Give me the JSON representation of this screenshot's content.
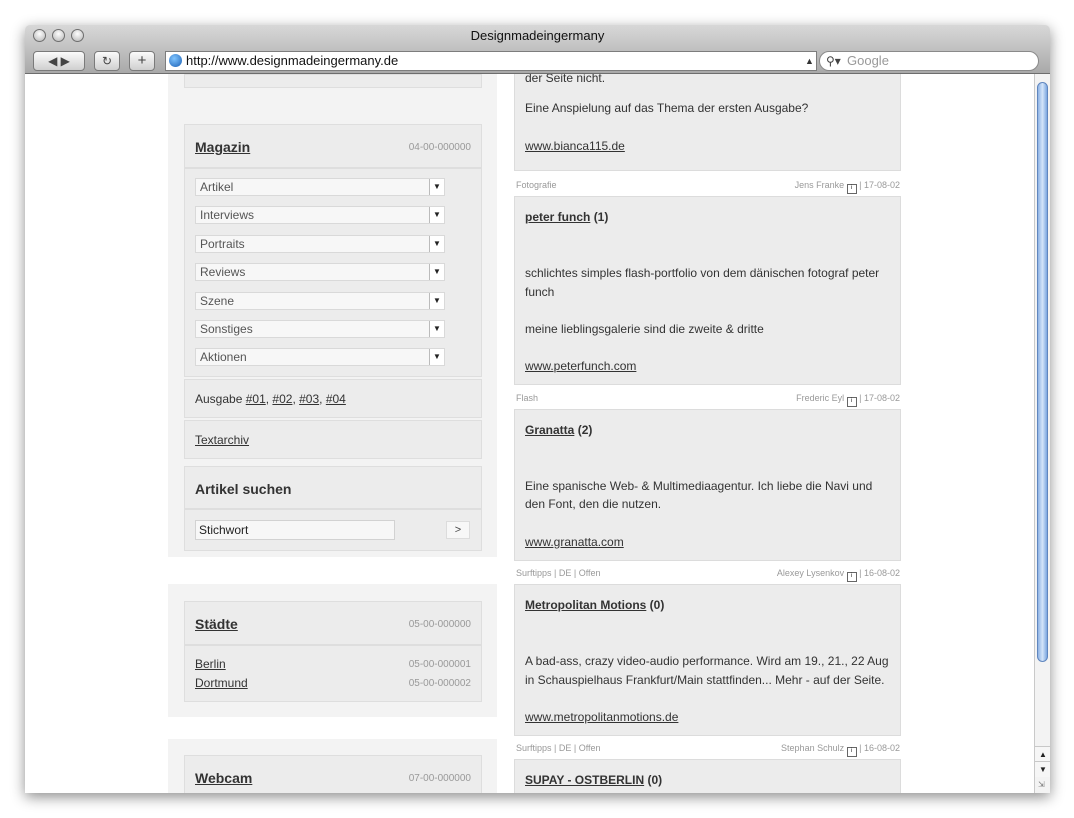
{
  "browser": {
    "title": "Designmadeingermany",
    "url": "http://www.designmadeingermany.de",
    "search_placeholder": "Google"
  },
  "magazin": {
    "heading": "Magazin",
    "code": "04-00-000000",
    "menus": [
      "Artikel",
      "Interviews",
      "Portraits",
      "Reviews",
      "Szene",
      "Sonstiges",
      "Aktionen"
    ],
    "ausgabe_label": "Ausgabe",
    "issues": [
      "#01",
      "#02",
      "#03",
      "#04"
    ],
    "textarchiv": "Textarchiv"
  },
  "search": {
    "heading": "Artikel suchen",
    "input_value": "Stichwort",
    "button": ">"
  },
  "staedte": {
    "heading": "Städte",
    "code": "05-00-000000",
    "items": [
      {
        "name": "Berlin",
        "code": "05-00-000001"
      },
      {
        "name": "Dortmund",
        "code": "05-00-000002"
      }
    ]
  },
  "webcam": {
    "heading": "Webcam",
    "code": "07-00-000000"
  },
  "first_post": {
    "partial": "der Seite nicht.",
    "text": "Eine Anspielung auf das Thema der ersten Ausgabe?",
    "link": "www.bianca115.de"
  },
  "posts": [
    {
      "category": "Fotografie",
      "author": "Jens Franke",
      "date": "| 17-08-02",
      "title": "peter funch",
      "count": "(1)",
      "body1": "schlichtes simples flash-portfolio von dem dänischen fotograf peter",
      "body2": "funch",
      "body3": "meine lieblingsgalerie sind die zweite & dritte",
      "link": "www.peterfunch.com"
    },
    {
      "category": "Flash",
      "author": "Frederic Eyl",
      "date": "| 17-08-02",
      "title": "Granatta",
      "count": "(2)",
      "body1": "Eine spanische Web- & Multimediaagentur. Ich liebe die Navi und",
      "body2": "den Font, den die nutzen.",
      "link": "www.granatta.com"
    },
    {
      "category": "Surftipps | DE | Offen",
      "author": "Alexey Lysenkov",
      "date": "| 16-08-02",
      "title": "Metropolitan Motions",
      "count": "(0)",
      "body1": "A bad-ass, crazy video-audio performance. Wird am 19., 21., 22 Aug",
      "body2": "in Schauspielhaus Frankfurt/Main stattfinden... Mehr - auf der Seite.",
      "link": "www.metropolitanmotions.de"
    },
    {
      "category": "Surftipps | DE | Offen",
      "author": "Stephan Schulz",
      "date": "| 16-08-02",
      "title": "SUPAY - OSTBERLIN",
      "count": "(0)"
    }
  ]
}
